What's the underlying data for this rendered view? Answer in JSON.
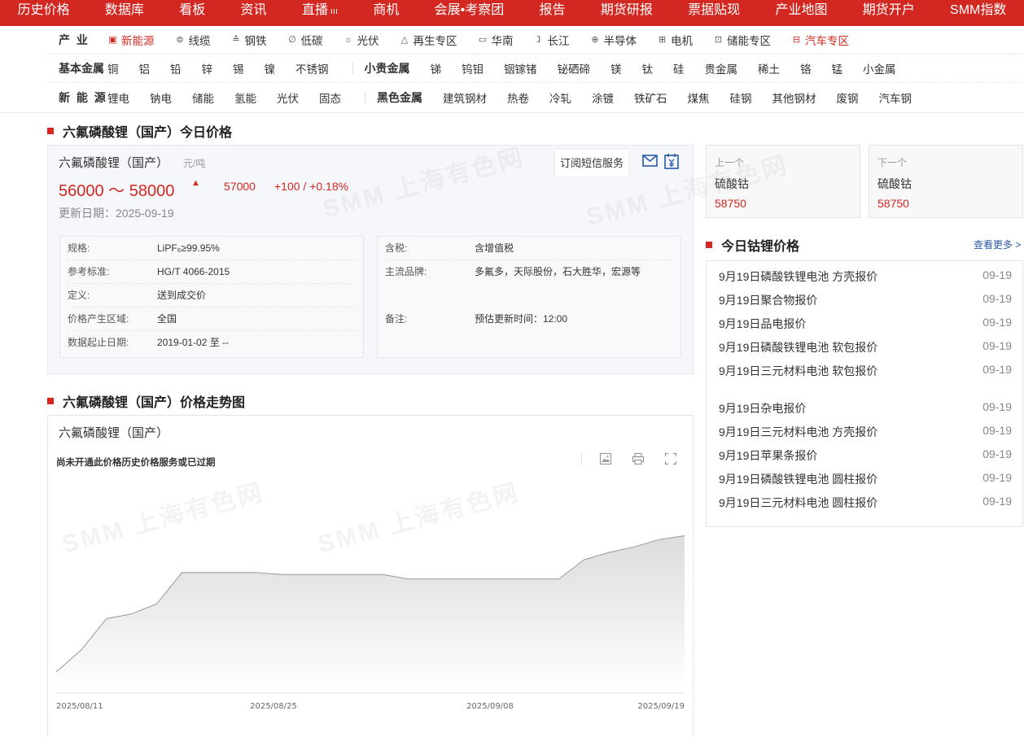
{
  "top_nav": [
    "历史价格",
    "数据库",
    "看板",
    "资讯",
    "直播",
    "商机",
    "会展•考察团",
    "报告",
    "期货研报",
    "票据贴现",
    "产业地图",
    "期货开户",
    "SMM指数"
  ],
  "row1": {
    "head": "产 业",
    "items": [
      {
        "label": "新能源",
        "icon": "battery-icon",
        "glyph": "▣",
        "red": true
      },
      {
        "label": "线缆",
        "icon": "cable-icon",
        "glyph": "⊜",
        "red": false
      },
      {
        "label": "钢铁",
        "icon": "steel-icon",
        "glyph": "≙",
        "red": false
      },
      {
        "label": "低碳",
        "icon": "leaf-icon",
        "glyph": "∅",
        "red": false
      },
      {
        "label": "光伏",
        "icon": "sun-icon",
        "glyph": "☼",
        "red": false
      },
      {
        "label": "再生专区",
        "icon": "recycle-icon",
        "glyph": "△",
        "red": false
      },
      {
        "label": "华南",
        "icon": "map-icon",
        "glyph": "▭",
        "red": false
      },
      {
        "label": "长江",
        "icon": "river-icon",
        "glyph": "ⱹ",
        "red": false
      },
      {
        "label": "半导体",
        "icon": "chip-icon",
        "glyph": "⊕",
        "red": false
      },
      {
        "label": "电机",
        "icon": "motor-icon",
        "glyph": "⊞",
        "red": false
      },
      {
        "label": "储能专区",
        "icon": "storage-icon",
        "glyph": "⊡",
        "red": false
      },
      {
        "label": "汽车专区",
        "icon": "car-icon",
        "glyph": "⊟",
        "red": true
      }
    ]
  },
  "row2": {
    "head": "基本金属",
    "items": [
      "铜",
      "铝",
      "铅",
      "锌",
      "锡",
      "镍",
      "不锈钢"
    ],
    "head2": "小贵金属",
    "items2": [
      "锑",
      "钨钼",
      "铟镓锗",
      "铋硒碲",
      "镁",
      "钛",
      "硅",
      "贵金属",
      "稀土",
      "铬",
      "锰",
      "小金属"
    ]
  },
  "row3": {
    "head": "新 能 源",
    "items": [
      "锂电",
      "钠电",
      "储能",
      "氢能",
      "光伏",
      "固态"
    ],
    "head2": "黑色金属",
    "items2": [
      "建筑钢材",
      "热卷",
      "冷轧",
      "涂镀",
      "铁矿石",
      "煤焦",
      "硅钢",
      "其他钢材",
      "废钢",
      "汽车钢"
    ]
  },
  "today_title": "六氟磷酸锂（国产）今日价格",
  "price": {
    "name": "六氟磷酸锂（国产）",
    "unit": "元/吨",
    "range": "56000 ～ 58000",
    "avg": "57000",
    "change": "+100 / +0.18%",
    "date": "更新日期：2025-09-19",
    "subscribe": "订阅短信服务"
  },
  "spec_left": [
    {
      "k": "规格:",
      "v": "LiPF₆≥99.95%"
    },
    {
      "k": "参考标准:",
      "v": "HG/T 4066-2015"
    },
    {
      "k": "定义:",
      "v": "送到成交价"
    },
    {
      "k": "价格产生区域:",
      "v": "全国"
    },
    {
      "k": "数据起止日期:",
      "v": "2019-01-02 至 --"
    }
  ],
  "spec_right": [
    {
      "k": "含税:",
      "v": "含增值税"
    },
    {
      "k": "主流品牌:",
      "v": "多氟多，天际股份，石大胜华，宏源等"
    },
    {
      "k": "备注:",
      "v": "预估更新时间：12:00"
    }
  ],
  "prev": {
    "label": "上一个",
    "name": "硫酸钴",
    "price": "58750"
  },
  "next": {
    "label": "下一个",
    "name": "硫酸钴",
    "price": "58750"
  },
  "cobalt_title": "今日钴锂价格",
  "more": "查看更多 >",
  "reports": [
    {
      "t": "9月19日磷酸铁锂电池 方壳报价",
      "d": "09-19"
    },
    {
      "t": "9月19日聚合物报价",
      "d": "09-19"
    },
    {
      "t": "9月19日品电报价",
      "d": "09-19"
    },
    {
      "t": "9月19日磷酸铁锂电池 软包报价",
      "d": "09-19"
    },
    {
      "t": "9月19日三元材料电池 软包报价",
      "d": "09-19"
    },
    {
      "t": "9月19日杂电报价",
      "d": "09-19"
    },
    {
      "t": "9月19日三元材料电池 方壳报价",
      "d": "09-19"
    },
    {
      "t": "9月19日苹果条报价",
      "d": "09-19"
    },
    {
      "t": "9月19日磷酸铁锂电池 圆柱报价",
      "d": "09-19"
    },
    {
      "t": "9月19日三元材料电池 圆柱报价",
      "d": "09-19"
    }
  ],
  "trend_title": "六氟磷酸锂（国产）价格走势图",
  "chart_name": "六氟磷酸锂（国产）",
  "chart_notice": "尚未开通此价格历史价格服务或已过期",
  "watermark": "SMM 上海有色网",
  "colors": {
    "brand_red": "#d32821",
    "link_blue": "#2a58a8"
  },
  "chart_data": {
    "type": "area",
    "x_labels": [
      "2025/08/11",
      "2025/08/25",
      "2025/09/08",
      "2025/09/19"
    ],
    "values": [
      48100,
      49300,
      51000,
      51250,
      51800,
      53500,
      53500,
      53500,
      53500,
      53400,
      53400,
      53400,
      53400,
      53400,
      53150,
      53150,
      53150,
      53150,
      53150,
      53150,
      53150,
      54200,
      54600,
      54900,
      55300,
      55500
    ],
    "ylim": [
      47000,
      56500
    ],
    "grid": false,
    "legend": "none"
  }
}
